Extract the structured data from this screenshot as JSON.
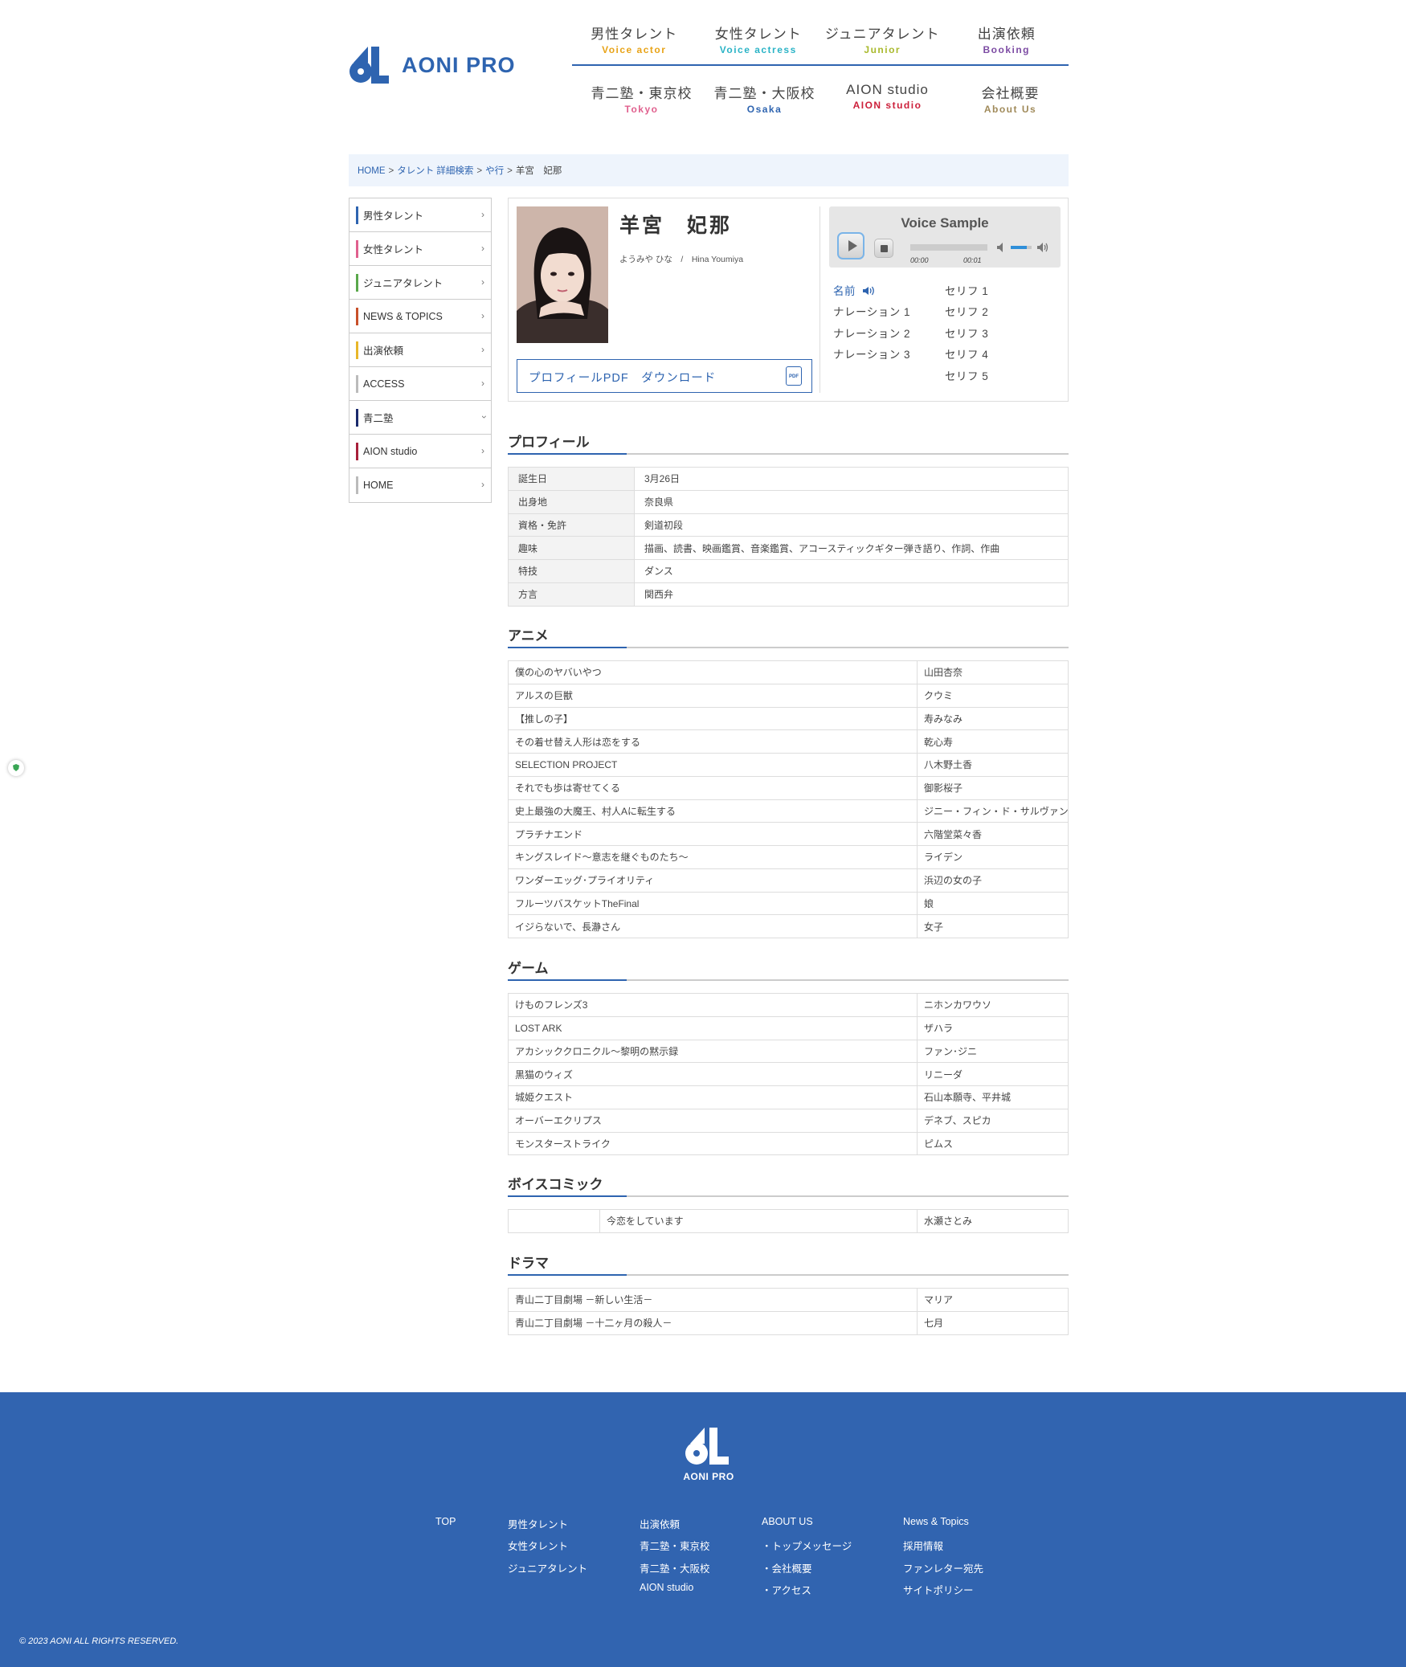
{
  "header": {
    "logo_text": "AONI PRO",
    "nav_row1": [
      {
        "jp": "男性タレント",
        "en": "Voice actor",
        "color": "#e8a317"
      },
      {
        "jp": "女性タレント",
        "en": "Voice actress",
        "color": "#2ab3c6"
      },
      {
        "jp": "ジュニアタレント",
        "en": "Junior",
        "color": "#a9b92c"
      },
      {
        "jp": "出演依頼",
        "en": "Booking",
        "color": "#7c4ba3"
      }
    ],
    "nav_row2": [
      {
        "jp": "青二塾・東京校",
        "en": "Tokyo",
        "color": "#e0608e"
      },
      {
        "jp": "青二塾・大阪校",
        "en": "Osaka",
        "color": "#2e64b0"
      },
      {
        "jp": "AION studio",
        "en": "AION studio",
        "color": "#cc1f3a"
      },
      {
        "jp": "会社概要",
        "en": "About Us",
        "color": "#a08a5a"
      }
    ]
  },
  "breadcrumb": {
    "items": [
      "HOME",
      "タレント 詳細検索",
      "や行"
    ],
    "current": "羊宮　妃那"
  },
  "sidebar": {
    "items": [
      {
        "label": "男性タレント",
        "color": "#2e64b0"
      },
      {
        "label": "女性タレント",
        "color": "#e0608e"
      },
      {
        "label": "ジュニアタレント",
        "color": "#5aa84b"
      },
      {
        "label": "NEWS & TOPICS",
        "color": "#c8502a"
      },
      {
        "label": "出演依頼",
        "color": "#e8b72a"
      },
      {
        "label": "ACCESS",
        "color": "#bbbbbb"
      },
      {
        "label": "青二塾",
        "color": "#1a2a6c"
      },
      {
        "label": "AION studio",
        "color": "#a8203a"
      },
      {
        "label": "HOME",
        "color": "#bbbbbb"
      }
    ]
  },
  "profile": {
    "name": "羊宮　妃那",
    "kana": "ようみや ひな　/　Hina Youmiya",
    "pdf_label": "プロフィールPDF　ダウンロード",
    "pdf_icon_text": "PDF"
  },
  "voice": {
    "title": "Voice Sample",
    "time_current": "00:00",
    "time_total": "00:01",
    "volume_level": 0.75,
    "samples_left": [
      "名前",
      "ナレーション 1",
      "ナレーション 2",
      "ナレーション 3"
    ],
    "samples_right": [
      "セリフ 1",
      "セリフ 2",
      "セリフ 3",
      "セリフ 4",
      "セリフ 5"
    ]
  },
  "sections": {
    "profile": {
      "title": "プロフィール",
      "rows": [
        {
          "k": "誕生日",
          "v": "3月26日"
        },
        {
          "k": "出身地",
          "v": "奈良県"
        },
        {
          "k": "資格・免許",
          "v": "剣道初段"
        },
        {
          "k": "趣味",
          "v": "描画、読書、映画鑑賞、音楽鑑賞、アコースティックギター弾き語り、作詞、作曲"
        },
        {
          "k": "特技",
          "v": "ダンス"
        },
        {
          "k": "方言",
          "v": "関西弁"
        }
      ]
    },
    "anime": {
      "title": "アニメ",
      "rows": [
        [
          "僕の心のヤバいやつ",
          "山田杏奈"
        ],
        [
          "アルスの巨獣",
          "クウミ"
        ],
        [
          "【推しの子】",
          "寿みなみ"
        ],
        [
          "その着せ替え人形は恋をする",
          "乾心寿"
        ],
        [
          "SELECTION PROJECT",
          "八木野土香"
        ],
        [
          "それでも歩は寄せてくる",
          "御影桜子"
        ],
        [
          "史上最強の大魔王、村人Aに転生する",
          "ジニー・フィン・ド・サルヴァン"
        ],
        [
          "プラチナエンド",
          "六階堂菜々香"
        ],
        [
          "キングスレイド～意志を継ぐものたち～",
          "ライデン"
        ],
        [
          "ワンダーエッグ･プライオリティ",
          "浜辺の女の子"
        ],
        [
          "フルーツバスケットTheFinal",
          "娘"
        ],
        [
          "イジらないで、長瀞さん",
          "女子"
        ]
      ]
    },
    "game": {
      "title": "ゲーム",
      "rows": [
        [
          "けものフレンズ3",
          "ニホンカワウソ"
        ],
        [
          "LOST ARK",
          "ザハラ"
        ],
        [
          "アカシッククロニクル～黎明の黙示録",
          "ファン･ジニ"
        ],
        [
          "黒猫のウィズ",
          "リニーダ"
        ],
        [
          "城姫クエスト",
          "石山本願寺、平井城"
        ],
        [
          "オーバーエクリプス",
          "デネブ、スピカ"
        ],
        [
          "モンスターストライク",
          "ピムス"
        ]
      ]
    },
    "voicecomic": {
      "title": "ボイスコミック",
      "rows": [
        [
          "",
          "今恋をしています",
          "水瀬さとみ"
        ]
      ]
    },
    "drama": {
      "title": "ドラマ",
      "rows": [
        [
          "青山二丁目劇場 －新しい生活－",
          "マリア"
        ],
        [
          "青山二丁目劇場 －十二ヶ月の殺人－",
          "七月"
        ]
      ]
    }
  },
  "footer": {
    "logo_text": "AONI PRO",
    "col1": [
      "TOP"
    ],
    "col2": [
      "男性タレント",
      "女性タレント",
      "ジュニアタレント"
    ],
    "col3": [
      "出演依頼",
      "青二塾・東京校",
      "青二塾・大阪校",
      "AION studio"
    ],
    "col4": [
      "ABOUT US",
      "・トップメッセージ",
      "・会社概要",
      "・アクセス"
    ],
    "col5": [
      "News & Topics",
      "採用情報",
      "ファンレター宛先",
      "サイトポリシー"
    ],
    "copyright": "© 2023 AONI ALL RIGHTS RESERVED."
  }
}
